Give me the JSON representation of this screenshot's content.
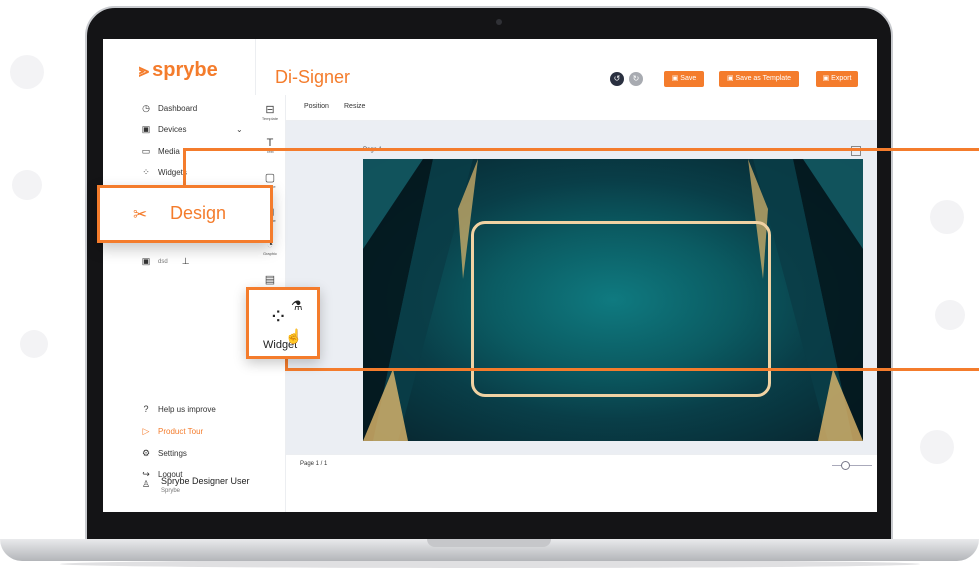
{
  "sidebar": {
    "logo": "sprybe",
    "items": [
      {
        "icon": "dashboard-icon",
        "label": "Dashboard"
      },
      {
        "icon": "devices-icon",
        "label": "Devices"
      },
      {
        "icon": "media-icon",
        "label": "Media"
      },
      {
        "icon": "widgets-icon",
        "label": "Widgets"
      }
    ],
    "mini_label": "dsd",
    "bottom_items": [
      {
        "icon": "help-icon",
        "label": "Help us improve"
      },
      {
        "icon": "product-tour-icon",
        "label": "Product Tour",
        "color": "#f47c2c"
      },
      {
        "icon": "settings-icon",
        "label": "Settings"
      },
      {
        "icon": "logout-icon",
        "label": "Logout"
      }
    ],
    "user": {
      "name": "Sprybe Designer User",
      "org": "Sprybe"
    }
  },
  "header": {
    "title": "Di-Signer",
    "buttons": {
      "save": "Save",
      "save_template": "Save as Template",
      "export": "Export"
    }
  },
  "tools": [
    "Template",
    "Text",
    "Image",
    "Shape",
    "Graphic"
  ],
  "tabs": [
    "Position",
    "Resize"
  ],
  "canvas": {
    "page_label": "Page 1",
    "footer_label": "Page 1 / 1"
  },
  "callouts": {
    "design": "Design",
    "widget": "Widget"
  },
  "colors": {
    "accent": "#f47c2c",
    "card_dark": "#07242d",
    "card_mid": "#0f7a80",
    "frame": "#f0d2a3"
  }
}
